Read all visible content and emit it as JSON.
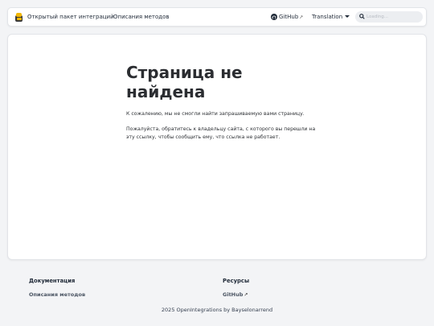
{
  "navbar": {
    "brand": "Открытый пакет интеграций",
    "methods": "Описания методов",
    "github": "GitHub",
    "translation": "Translation",
    "search_placeholder": "Loading..."
  },
  "page": {
    "title": "Страница не найдена",
    "para1": "К сожалению, мы не смогли найти запрашиваемую вами страницу.",
    "para2": "Пожалуйста, обратитесь к владельцу сайта, с которого вы перешли на эту ссылку, чтобы сообщить ему, что ссылка не работает."
  },
  "footer": {
    "docs_heading": "Документация",
    "docs_link": "Описания методов",
    "resources_heading": "Ресурсы",
    "resources_link": "GitHub",
    "copyright": "2025 OpenIntegrations by Bayselonarrend"
  },
  "icons": {
    "logo": "logo-icon",
    "github": "github-icon",
    "external": "external-link-icon",
    "translation": "chevron-down-icon",
    "search": "search-icon"
  }
}
